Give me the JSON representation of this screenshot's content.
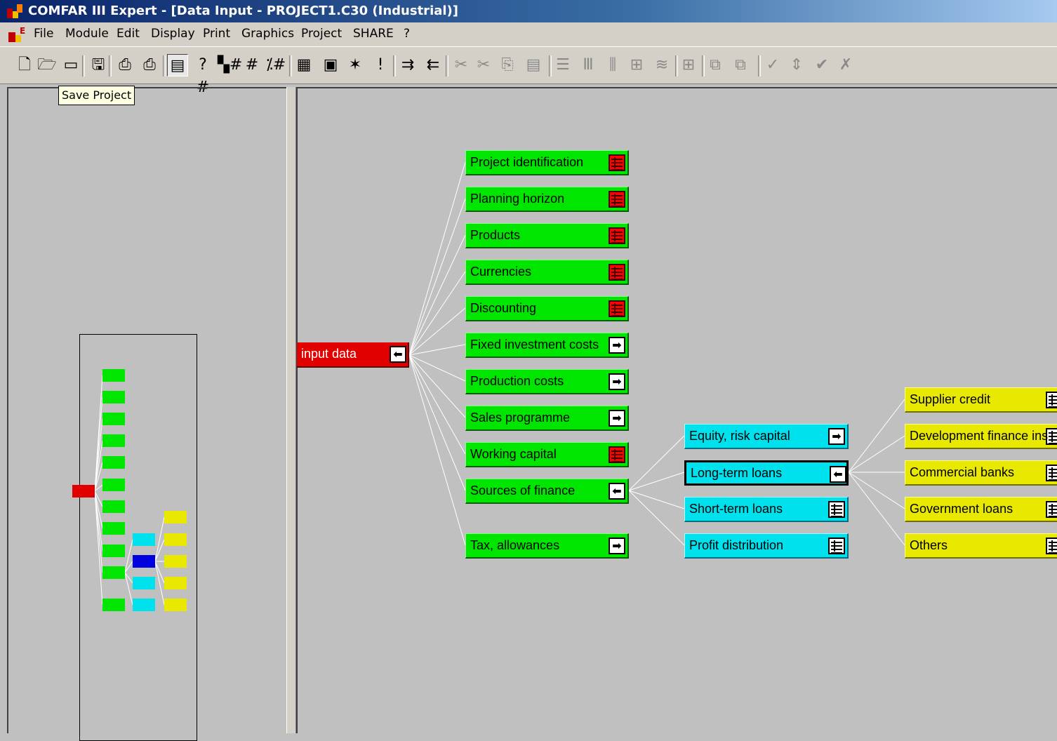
{
  "window": {
    "title": "COMFAR III Expert - [Data Input - PROJECT1.C30 (Industrial)]"
  },
  "menu": [
    "File",
    "Module",
    "Edit",
    "Display",
    "Print",
    "Graphics",
    "Project",
    "SHARE",
    "?"
  ],
  "toolbar": {
    "buttons": [
      {
        "name": "new-icon",
        "glyph": "🗋",
        "enabled": true
      },
      {
        "name": "open-icon",
        "glyph": "🗁",
        "enabled": true
      },
      {
        "name": "open-folder-icon",
        "glyph": "▭",
        "enabled": true
      },
      {
        "name": "save-icon",
        "glyph": "🖫",
        "enabled": true
      },
      {
        "name": "print-icon",
        "glyph": "⎙",
        "enabled": true
      },
      {
        "name": "print-setup-icon",
        "glyph": "⎙",
        "enabled": true
      },
      {
        "name": "data-input-icon",
        "glyph": "▤",
        "enabled": true,
        "pressed": true
      },
      {
        "name": "help-number-icon",
        "glyph": "?#",
        "enabled": true
      },
      {
        "name": "number-format-icon",
        "glyph": "▚#",
        "enabled": true
      },
      {
        "name": "grid-number-icon",
        "glyph": "#",
        "enabled": true
      },
      {
        "name": "percent-number-icon",
        "glyph": "⁒#",
        "enabled": true
      },
      {
        "name": "table-icon",
        "glyph": "▦",
        "enabled": true
      },
      {
        "name": "calculator-icon",
        "glyph": "▣",
        "enabled": true
      },
      {
        "name": "new-item-icon",
        "glyph": "✶",
        "enabled": true
      },
      {
        "name": "exclamation-icon",
        "glyph": "!",
        "enabled": true
      },
      {
        "name": "expand-tree-icon",
        "glyph": "⇉",
        "enabled": true
      },
      {
        "name": "collapse-tree-icon",
        "glyph": "⇇",
        "enabled": true
      },
      {
        "name": "cut-icon",
        "glyph": "✂",
        "enabled": false
      },
      {
        "name": "cut-percent-icon",
        "glyph": "✂",
        "enabled": false
      },
      {
        "name": "copy-icon",
        "glyph": "⎘",
        "enabled": false
      },
      {
        "name": "paste-icon",
        "glyph": "▤",
        "enabled": false
      },
      {
        "name": "rows-icon",
        "glyph": "☰",
        "enabled": false
      },
      {
        "name": "columns-icon",
        "glyph": "Ⅲ",
        "enabled": false
      },
      {
        "name": "insert-column-icon",
        "glyph": "⫼",
        "enabled": false
      },
      {
        "name": "grid-select-icon",
        "glyph": "⊞",
        "enabled": false
      },
      {
        "name": "fill-icon",
        "glyph": "≋",
        "enabled": false
      },
      {
        "name": "grid-hash-icon",
        "glyph": "⊞",
        "enabled": false
      },
      {
        "name": "copy-block-icon",
        "glyph": "⧉",
        "enabled": false
      },
      {
        "name": "move-block-icon",
        "glyph": "⧉",
        "enabled": false
      },
      {
        "name": "check-icon",
        "glyph": "✓",
        "enabled": false
      },
      {
        "name": "up-down-icon",
        "glyph": "⇕",
        "enabled": false
      },
      {
        "name": "check-all-icon",
        "glyph": "✔",
        "enabled": false
      },
      {
        "name": "uncheck-all-icon",
        "glyph": "✗",
        "enabled": false
      }
    ]
  },
  "tooltip": "Save Project",
  "tree": {
    "root": {
      "label": "input data"
    },
    "level1": [
      {
        "label": "Project identification",
        "icon": "table-red"
      },
      {
        "label": "Planning horizon",
        "icon": "table-red"
      },
      {
        "label": "Products",
        "icon": "table-red"
      },
      {
        "label": "Currencies",
        "icon": "table-red"
      },
      {
        "label": "Discounting",
        "icon": "table-red"
      },
      {
        "label": "Fixed investment costs",
        "icon": "arrow-right"
      },
      {
        "label": "Production costs",
        "icon": "arrow-right"
      },
      {
        "label": "Sales programme",
        "icon": "arrow-right"
      },
      {
        "label": "Working capital",
        "icon": "table-red"
      },
      {
        "label": "Sources of finance",
        "icon": "arrow-left"
      },
      {
        "label": "Tax, allowances",
        "icon": "arrow-right"
      }
    ],
    "level2": [
      {
        "label": "Equity, risk capital",
        "icon": "arrow-right"
      },
      {
        "label": "Long-term loans",
        "icon": "arrow-left",
        "selected": true
      },
      {
        "label": "Short-term loans",
        "icon": "table-white"
      },
      {
        "label": "Profit distribution",
        "icon": "table-white"
      }
    ],
    "level3": [
      {
        "label": "Supplier credit",
        "icon": "table-white"
      },
      {
        "label": "Development finance ins",
        "icon": "table-white"
      },
      {
        "label": "Commercial banks",
        "icon": "table-white"
      },
      {
        "label": "Government loans",
        "icon": "table-white"
      },
      {
        "label": "Others",
        "icon": "table-white"
      }
    ]
  },
  "colors": {
    "root": "#e00000",
    "level1": "#00e600",
    "level2": "#00e1ee",
    "level2_selected_overview": "#0000e0",
    "level3": "#e8e800",
    "connector": "#ffffff"
  }
}
